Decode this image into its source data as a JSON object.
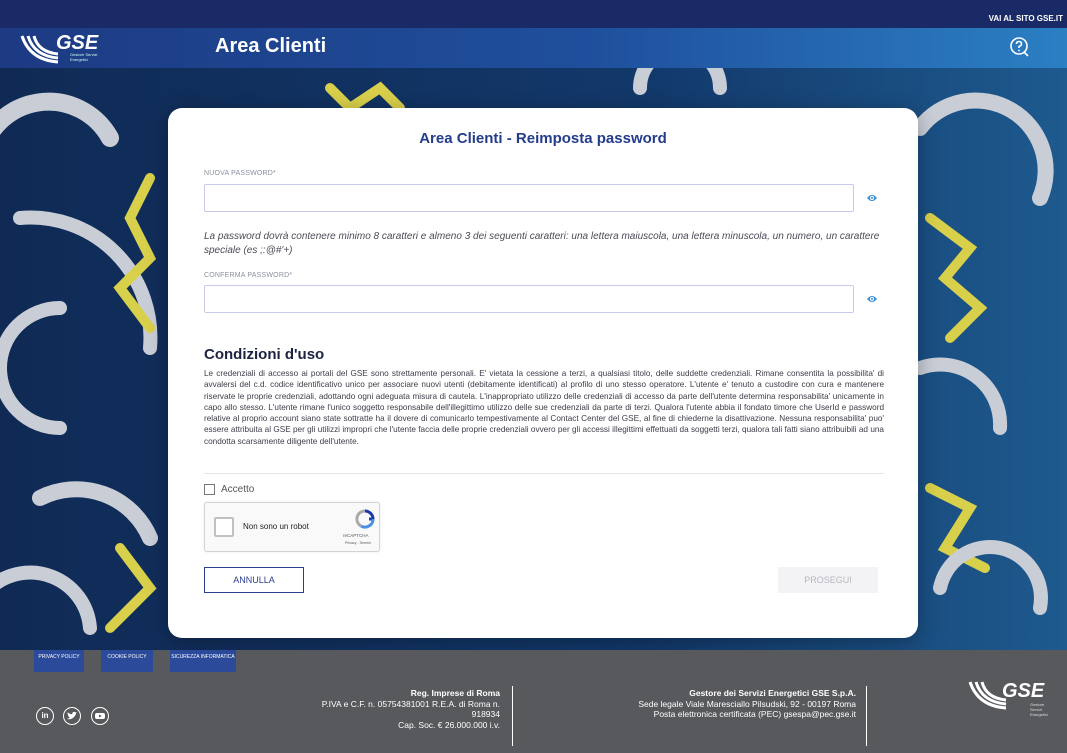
{
  "top": {
    "site_link": "VAI AL SITO GSE.IT"
  },
  "header": {
    "logo_text": "GSE",
    "logo_sub": "Gestore Servizi Energetici",
    "title": "Area Clienti"
  },
  "form": {
    "title": "Area Clienti - Reimposta password",
    "new_password": {
      "label": "NUOVA PASSWORD*",
      "value": ""
    },
    "hint": "La password dovrà contenere minimo 8 caratteri e almeno 3 dei seguenti caratteri: una lettera maiuscola, una lettera minuscola, un numero, un carattere speciale (es ;:@#'+)",
    "confirm_password": {
      "label": "CONFERMA PASSWORD*",
      "value": ""
    },
    "conditions_title": "Condizioni d'uso",
    "conditions_text": "Le credenziali di accesso ai portali del GSE sono strettamente personali. E' vietata la cessione a terzi, a qualsiasi titolo, delle suddette credenziali. Rimane consentita la possibilita' di avvalersi del c.d. codice identificativo unico per associare nuovi utenti (debitamente identificati) al profilo di uno stesso operatore. L'utente e' tenuto a custodire con cura e mantenere riservate le proprie credenziali, adottando ogni adeguata misura di cautela. L'inappropriato utilizzo delle credenziali di accesso da parte dell'utente determina responsabilita' unicamente in capo allo stesso. L'utente rimane l'unico soggetto responsabile dell'illegittimo utilizzo delle sue credenziali da parte di terzi. Qualora l'utente abbia il fondato timore che UserId e password relative al proprio account siano state sottratte ha il dovere di comunicarlo tempestivamente al Contact Center del GSE, al fine di chiederne la disattivazione. Nessuna responsabilita' puo' essere attribuita al GSE per gli utilizzi impropri che l'utente faccia delle proprie credenziali ovvero per gli accessi illegittimi effettuati da soggetti terzi, qualora tali fatti siano attribuibili ad una condotta scarsamente diligente dell'utente.",
    "accept_label": "Accetto",
    "accept_checked": false,
    "recaptcha": {
      "label": "Non sono un robot",
      "brand": "reCAPTCHA",
      "links": "Privacy - Termini"
    },
    "cancel_label": "ANNULLA",
    "continue_label": "PROSEGUI"
  },
  "footer": {
    "links": [
      "PRIVACY POLICY",
      "COOKIE POLICY",
      "SICUREZZA INFORMATICA"
    ],
    "social": [
      "in",
      "twitter",
      "youtube"
    ],
    "reg_title": "Reg. Imprese di Roma",
    "reg_line1": "P.IVA e C.F. n. 05754381001 R.E.A. di Roma n.",
    "reg_line2": "918934",
    "reg_line3": "Cap. Soc. € 26.000.000 i.v.",
    "company_title": "Gestore dei Servizi Energetici GSE S.p.A.",
    "company_line1": "Sede legale Viale Maresciallo Pilsudski, 92 - 00197 Roma",
    "company_line2": "Posta elettronica certificata (PEC) gsespa@pec.gse.it",
    "logo_text": "GSE",
    "logo_sub": "Gestore Servizi Energetici"
  }
}
